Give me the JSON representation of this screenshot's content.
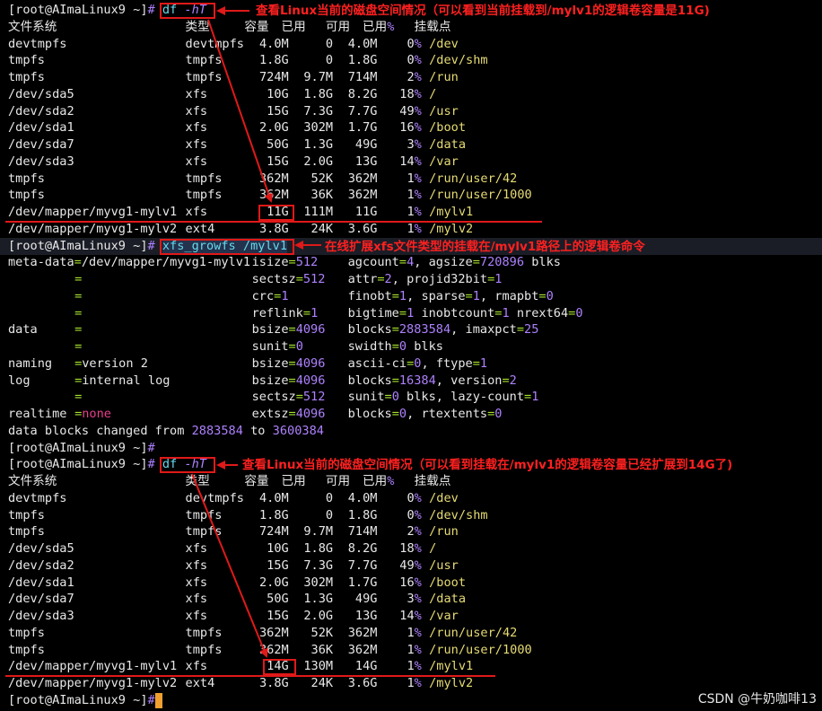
{
  "prompt": {
    "user_host": "[root@AImaLinux9 ~]",
    "hash": "#"
  },
  "commands": {
    "df": "df",
    "df_opt": "-hT",
    "grow": "xfs_growfs /mylv1"
  },
  "annotations": {
    "first": "查看Linux当前的磁盘空间情况（可以看到当前挂载到/mylv1的逻辑卷容量是11G)",
    "second": "在线扩展xfs文件类型的挂载在/mylv1路径上的逻辑卷命令",
    "third": "查看Linux当前的磁盘空间情况（可以看到挂载在/mylv1的逻辑卷容量已经扩展到14G了)"
  },
  "df_header": {
    "fs": "文件系统",
    "type": "类型",
    "size": "容量",
    "used": "已用",
    "avail": "可用",
    "pct": "已用%",
    "mount": "挂载点"
  },
  "df_before": [
    {
      "fs": "devtmpfs",
      "type": "devtmpfs",
      "size": "4.0M",
      "used": "0",
      "avail": "4.0M",
      "pct": "0%",
      "mount": "/dev"
    },
    {
      "fs": "tmpfs",
      "type": "tmpfs",
      "size": "1.8G",
      "used": "0",
      "avail": "1.8G",
      "pct": "0%",
      "mount": "/dev/shm"
    },
    {
      "fs": "tmpfs",
      "type": "tmpfs",
      "size": "724M",
      "used": "9.7M",
      "avail": "714M",
      "pct": "2%",
      "mount": "/run"
    },
    {
      "fs": "/dev/sda5",
      "type": "xfs",
      "size": "10G",
      "used": "1.8G",
      "avail": "8.2G",
      "pct": "18%",
      "mount": "/"
    },
    {
      "fs": "/dev/sda2",
      "type": "xfs",
      "size": "15G",
      "used": "7.3G",
      "avail": "7.7G",
      "pct": "49%",
      "mount": "/usr"
    },
    {
      "fs": "/dev/sda1",
      "type": "xfs",
      "size": "2.0G",
      "used": "302M",
      "avail": "1.7G",
      "pct": "16%",
      "mount": "/boot"
    },
    {
      "fs": "/dev/sda7",
      "type": "xfs",
      "size": "50G",
      "used": "1.3G",
      "avail": "49G",
      "pct": "3%",
      "mount": "/data"
    },
    {
      "fs": "/dev/sda3",
      "type": "xfs",
      "size": "15G",
      "used": "2.0G",
      "avail": "13G",
      "pct": "14%",
      "mount": "/var"
    },
    {
      "fs": "tmpfs",
      "type": "tmpfs",
      "size": "362M",
      "used": "52K",
      "avail": "362M",
      "pct": "1%",
      "mount": "/run/user/42"
    },
    {
      "fs": "tmpfs",
      "type": "tmpfs",
      "size": "362M",
      "used": "36K",
      "avail": "362M",
      "pct": "1%",
      "mount": "/run/user/1000"
    },
    {
      "fs": "/dev/mapper/myvg1-mylv1",
      "type": "xfs",
      "size": "11G",
      "used": "111M",
      "avail": "11G",
      "pct": "1%",
      "mount": "/mylv1"
    },
    {
      "fs": "/dev/mapper/myvg1-mylv2",
      "type": "ext4",
      "size": "3.8G",
      "used": "24K",
      "avail": "3.6G",
      "pct": "1%",
      "mount": "/mylv2"
    }
  ],
  "grow_output": [
    {
      "left": "meta-data=/dev/mapper/myvg1-mylv1",
      "mid": [
        [
          "isize",
          "512"
        ]
      ],
      "right": [
        [
          "agcount",
          "4"
        ],
        [
          "agsize",
          "720896"
        ]
      ],
      "right_tail": " blks"
    },
    {
      "left": "=",
      "mid": [
        [
          "sectsz",
          "512"
        ]
      ],
      "right": [
        [
          "attr",
          "2"
        ],
        [
          "projid32bit",
          "1"
        ]
      ],
      "right_tail": ""
    },
    {
      "left": "=",
      "mid": [
        [
          "crc",
          "1"
        ]
      ],
      "right": [
        [
          "finobt",
          "1"
        ],
        [
          "sparse",
          "1"
        ],
        [
          "rmapbt",
          "0"
        ]
      ],
      "right_tail": ""
    },
    {
      "left": "=",
      "mid": [
        [
          "reflink",
          "1"
        ]
      ],
      "right": [
        [
          "bigtime",
          "1"
        ],
        [
          "inobtcount",
          "1"
        ],
        [
          "nrext64",
          "0"
        ]
      ],
      "right_tail": "",
      "right_sep": " "
    },
    {
      "label": "data",
      "left": "=",
      "mid": [
        [
          "bsize",
          "4096"
        ]
      ],
      "right": [
        [
          "blocks",
          "2883584"
        ],
        [
          "imaxpct",
          "25"
        ]
      ],
      "right_tail": ""
    },
    {
      "left": "=",
      "mid": [
        [
          "sunit",
          "0"
        ]
      ],
      "right": [
        [
          "swidth",
          "0"
        ]
      ],
      "right_tail": " blks"
    },
    {
      "label": "naming",
      "left": "=version 2",
      "mid": [
        [
          "bsize",
          "4096"
        ]
      ],
      "right": [
        [
          "ascii-ci",
          "0"
        ],
        [
          "ftype",
          "1"
        ]
      ],
      "right_tail": ""
    },
    {
      "label": "log",
      "left": "=internal log",
      "mid": [
        [
          "bsize",
          "4096"
        ]
      ],
      "right": [
        [
          "blocks",
          "16384"
        ],
        [
          "version",
          "2"
        ]
      ],
      "right_tail": ""
    },
    {
      "left": "=",
      "mid": [
        [
          "sectsz",
          "512"
        ]
      ],
      "right": [
        [
          "sunit",
          "0"
        ]
      ],
      "right_tail": " blks, lazy-count=1",
      "lazy": true
    },
    {
      "label": "realtime",
      "left": "=none",
      "mid": [
        [
          "extsz",
          "4096"
        ]
      ],
      "right": [
        [
          "blocks",
          "0"
        ],
        [
          "rtextents",
          "0"
        ]
      ],
      "right_tail": "",
      "none": true
    }
  ],
  "grow_summary": {
    "text": "data blocks changed from ",
    "from": "2883584",
    "to_word": " to ",
    "to": "3600384"
  },
  "df_after": [
    {
      "fs": "devtmpfs",
      "type": "devtmpfs",
      "size": "4.0M",
      "used": "0",
      "avail": "4.0M",
      "pct": "0%",
      "mount": "/dev"
    },
    {
      "fs": "tmpfs",
      "type": "tmpfs",
      "size": "1.8G",
      "used": "0",
      "avail": "1.8G",
      "pct": "0%",
      "mount": "/dev/shm"
    },
    {
      "fs": "tmpfs",
      "type": "tmpfs",
      "size": "724M",
      "used": "9.7M",
      "avail": "714M",
      "pct": "2%",
      "mount": "/run"
    },
    {
      "fs": "/dev/sda5",
      "type": "xfs",
      "size": "10G",
      "used": "1.8G",
      "avail": "8.2G",
      "pct": "18%",
      "mount": "/"
    },
    {
      "fs": "/dev/sda2",
      "type": "xfs",
      "size": "15G",
      "used": "7.3G",
      "avail": "7.7G",
      "pct": "49%",
      "mount": "/usr"
    },
    {
      "fs": "/dev/sda1",
      "type": "xfs",
      "size": "2.0G",
      "used": "302M",
      "avail": "1.7G",
      "pct": "16%",
      "mount": "/boot"
    },
    {
      "fs": "/dev/sda7",
      "type": "xfs",
      "size": "50G",
      "used": "1.3G",
      "avail": "49G",
      "pct": "3%",
      "mount": "/data"
    },
    {
      "fs": "/dev/sda3",
      "type": "xfs",
      "size": "15G",
      "used": "2.0G",
      "avail": "13G",
      "pct": "14%",
      "mount": "/var"
    },
    {
      "fs": "tmpfs",
      "type": "tmpfs",
      "size": "362M",
      "used": "52K",
      "avail": "362M",
      "pct": "1%",
      "mount": "/run/user/42"
    },
    {
      "fs": "tmpfs",
      "type": "tmpfs",
      "size": "362M",
      "used": "36K",
      "avail": "362M",
      "pct": "1%",
      "mount": "/run/user/1000"
    },
    {
      "fs": "/dev/mapper/myvg1-mylv1",
      "type": "xfs",
      "size": "14G",
      "used": "130M",
      "avail": "14G",
      "pct": "1%",
      "mount": "/mylv1"
    },
    {
      "fs": "/dev/mapper/myvg1-mylv2",
      "type": "ext4",
      "size": "3.8G",
      "used": "24K",
      "avail": "3.6G",
      "pct": "1%",
      "mount": "/mylv2"
    }
  ],
  "watermark": "CSDN @牛奶咖啡13"
}
